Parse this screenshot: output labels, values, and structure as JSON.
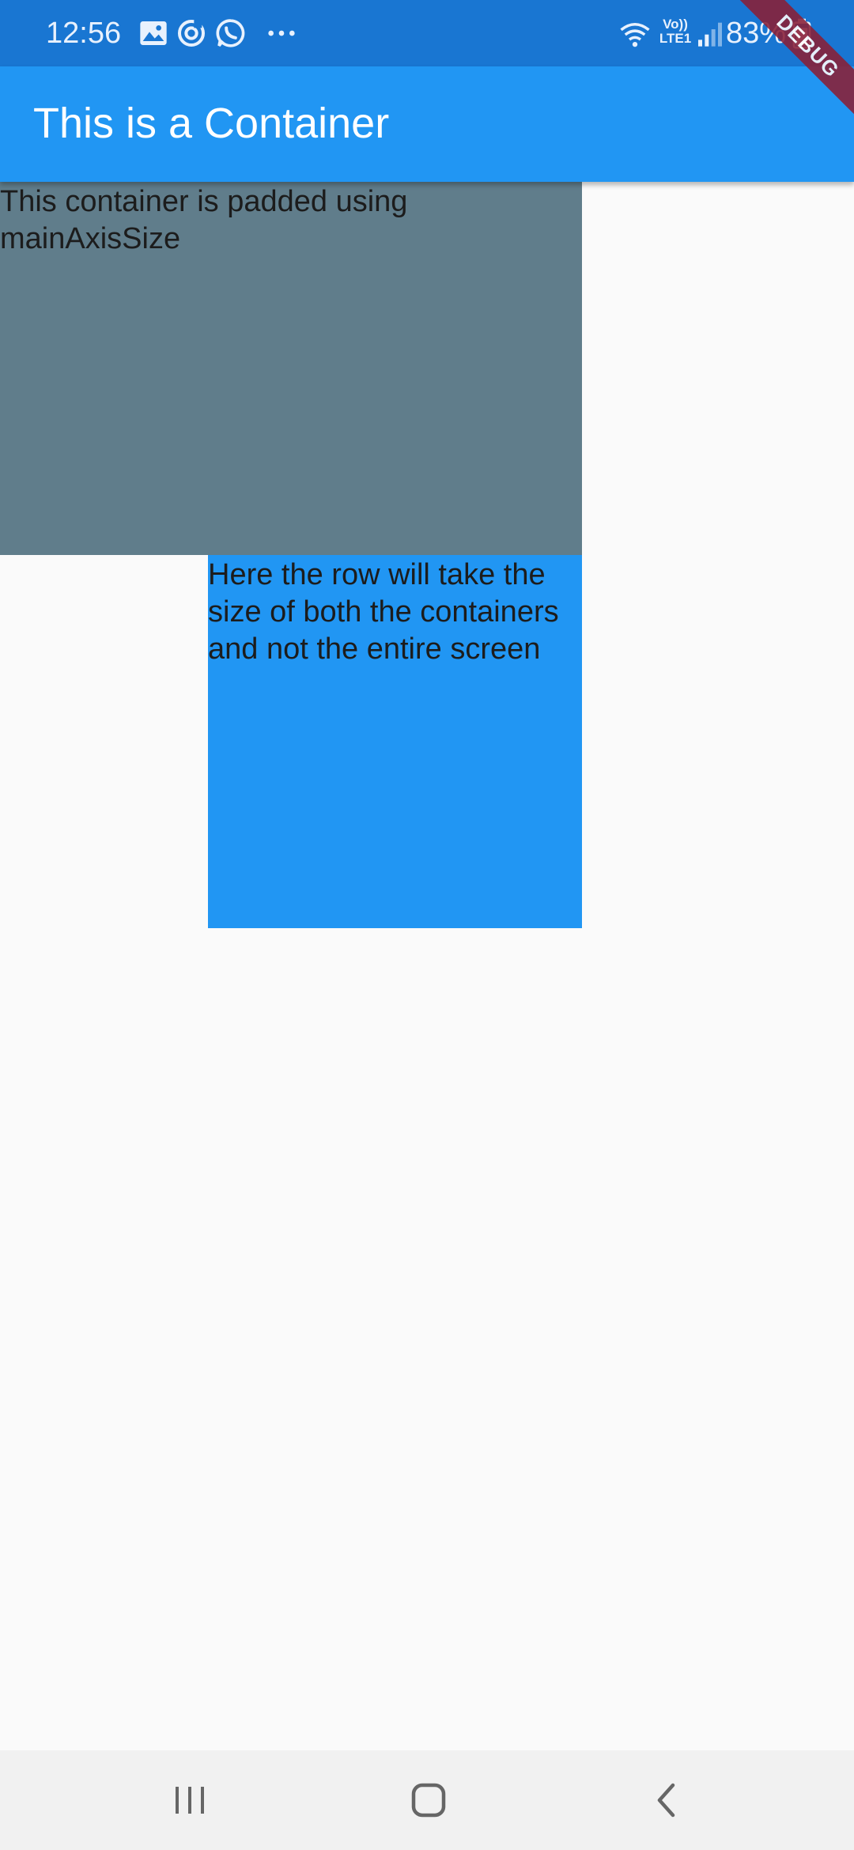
{
  "status_bar": {
    "time": "12:56",
    "battery": "83%",
    "notification_icons": [
      "gallery-icon",
      "sync-icon",
      "whatsapp-icon",
      "more-dots-icon"
    ],
    "system_icons": [
      "wifi-icon",
      "volte-icon",
      "signal-icon",
      "battery-icon"
    ],
    "volte_label": "Vo))",
    "lte_label": "LTE1"
  },
  "app_bar": {
    "title": "This is a Container",
    "color": "#2196f3"
  },
  "debug_banner": {
    "label": "DEBUG"
  },
  "containers": [
    {
      "text": "This container is padded using mainAxisSize",
      "color": "#607d8b"
    },
    {
      "text": "Here the row will take the size of both the containers and not the entire screen",
      "color": "#2196f3"
    }
  ],
  "nav_bar": {
    "buttons": [
      "recents-icon",
      "home-icon",
      "back-icon"
    ]
  }
}
